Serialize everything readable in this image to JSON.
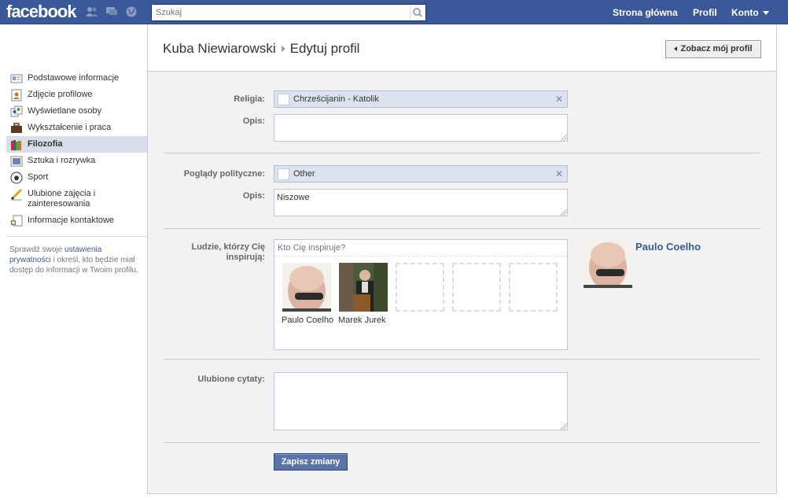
{
  "topbar": {
    "logo": "facebook",
    "search_placeholder": "Szukaj",
    "nav": [
      "Strona główna",
      "Profil",
      "Konto"
    ]
  },
  "sidebar": {
    "items": [
      {
        "label": "Podstawowe informacje",
        "icon": "id-card-icon"
      },
      {
        "label": "Zdjęcie profilowe",
        "icon": "profile-photo-icon"
      },
      {
        "label": "Wyświetlane osoby",
        "icon": "people-icon"
      },
      {
        "label": "Wykształcenie i praca",
        "icon": "briefcase-icon"
      },
      {
        "label": "Filozofia",
        "icon": "books-icon",
        "active": true
      },
      {
        "label": "Sztuka i rozrywka",
        "icon": "film-icon"
      },
      {
        "label": "Sport",
        "icon": "soccer-ball-icon"
      },
      {
        "label": "Ulubione zajęcia i zainteresowania",
        "icon": "pencil-icon"
      },
      {
        "label": "Informacje kontaktowe",
        "icon": "contact-icon"
      }
    ],
    "privacy": {
      "before": "Sprawdź swoje ",
      "link": "ustawienia prywatności",
      "after": " i określ, kto będzie miał dostęp do informacji w Twoim profilu."
    }
  },
  "header": {
    "name": "Kuba Niewiarowski",
    "page": "Edytuj profil",
    "view_profile": "Zobacz mój profil"
  },
  "form": {
    "religion_label": "Religia:",
    "religion_value": "Chrześcijanin - Katolik",
    "desc_label": "Opis:",
    "religion_desc": "",
    "politics_label": "Poglądy polityczne:",
    "politics_value": "Other",
    "politics_desc": "Niszowe",
    "inspire_label": "Ludzie, którzy Cię inspirują:",
    "inspire_placeholder": "Kto Cię inspiruje?",
    "inspire_people": [
      "Paulo Coelho",
      "Marek Jurek"
    ],
    "featured_person": "Paulo Coelho",
    "quotes_label": "Ulubione cytaty:",
    "quotes_value": "",
    "save": "Zapisz zmiany"
  },
  "colors": {
    "brand": "#3b5998",
    "active_nav": "#d8dfea",
    "token_bg": "#dde3ee"
  }
}
